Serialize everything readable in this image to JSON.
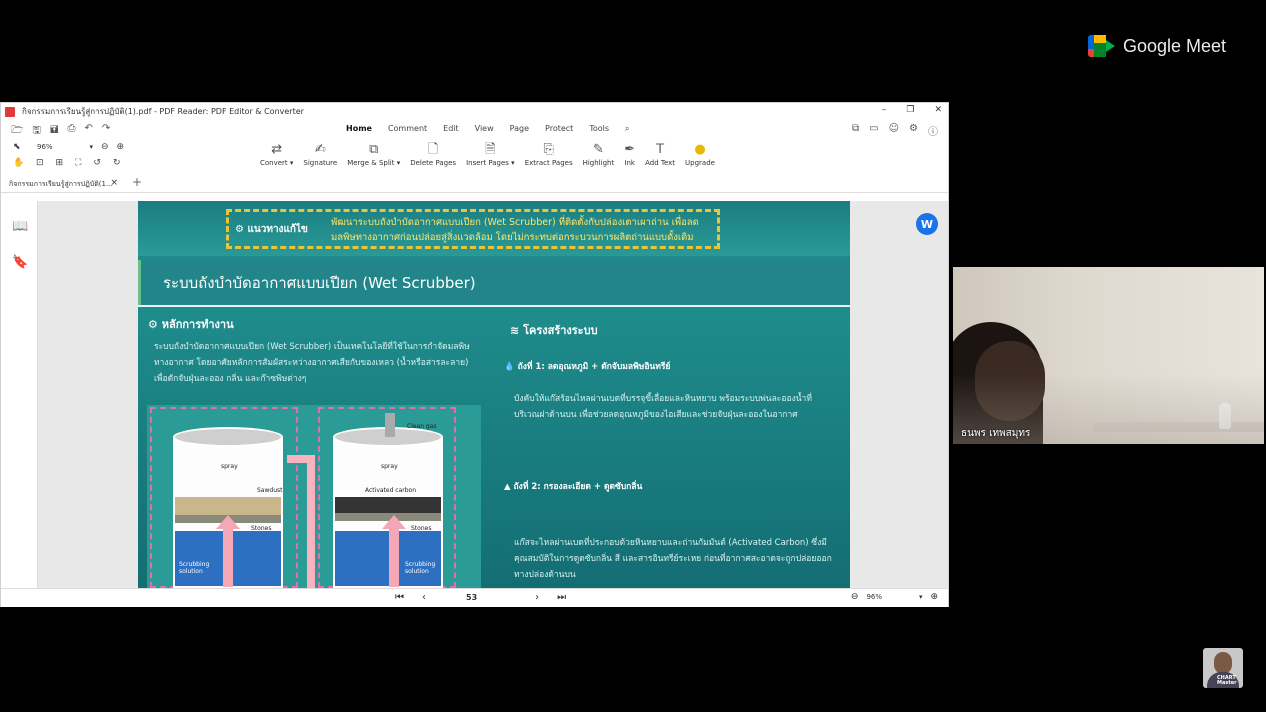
{
  "meet": {
    "brand": "Google Meet"
  },
  "window": {
    "title": "กิจกรรมการเรียนรู้สู่การปฏิบัติ(1).pdf - PDF Reader: PDF Editor & Converter",
    "controls": [
      "–",
      "❐",
      "✕"
    ]
  },
  "menu": {
    "items": [
      "Home",
      "Comment",
      "Edit",
      "View",
      "Page",
      "Protect",
      "Tools"
    ],
    "active": "Home"
  },
  "toolbar": {
    "zoom": "96%",
    "tools": [
      {
        "label": "Convert ▾",
        "icon": "convert-icon"
      },
      {
        "label": "Signature",
        "icon": "signature-icon"
      },
      {
        "label": "Merge & Split ▾",
        "icon": "merge-icon"
      },
      {
        "label": "Delete Pages",
        "icon": "delete-pages-icon"
      },
      {
        "label": "Insert Pages ▾",
        "icon": "insert-pages-icon"
      },
      {
        "label": "Extract Pages",
        "icon": "extract-pages-icon"
      },
      {
        "label": "Highlight",
        "icon": "highlight-icon"
      },
      {
        "label": "Ink",
        "icon": "ink-icon"
      },
      {
        "label": "Add Text",
        "icon": "add-text-icon"
      },
      {
        "label": "Upgrade",
        "icon": "upgrade-icon"
      }
    ]
  },
  "tab": {
    "label": "กิจกรรมการเรียนรู้สู่การปฏิบัติ(1..."
  },
  "viewer_avatar": "W",
  "pdf": {
    "solution_label": "แนวทางแก้ไข",
    "solution_text": "พัฒนาระบบถังบำบัดอากาศแบบเปียก (Wet Scrubber) ที่ติดตั้งกับปล่องเตาเผาถ่าน เพื่อลดมลพิษทางอากาศก่อนปล่อยสู่สิ่งแวดล้อม โดยไม่กระทบต่อกระบวนการผลิตถ่านแบบดั้งเดิม",
    "title": "ระบบถังบำบัดอากาศแบบเปียก (Wet Scrubber)",
    "principle_head": "หลักการทำงาน",
    "principle_text": "ระบบถังบำบัดอากาศแบบเปียก (Wet Scrubber) เป็นเทคโนโลยีที่ใช้ในการกำจัดมลพิษทางอากาศ โดยอาศัยหลักการสัมผัสระหว่างอากาศเสียกับของเหลว (น้ำหรือสารละลาย) เพื่อดักจับฝุ่นละออง กลิ่น และก๊าซพิษต่างๆ",
    "structure_head": "โครงสร้างระบบ",
    "step1_head": "ถังที่ 1: ลดอุณหภูมิ + ดักจับมลพิษอินทรีย์",
    "step1_text": "บังคับให้แก๊สร้อนไหลผ่านเบดที่บรรจุขี้เลื่อยและหินหยาบ พร้อมระบบพ่นละอองน้ำที่บริเวณฝาด้านบน เพื่อช่วยลดอุณหภูมิของไอเสียและช่วยจับฝุ่นละอองในอากาศ",
    "step2_head": "ถังที่ 2: กรองละเอียด + ดูดซับกลิ่น",
    "step2_text": "แก๊สจะไหลผ่านเบดที่ประกอบด้วยหินหยาบและถ่านกัมมันต์ (Activated Carbon) ซึ่งมีคุณสมบัติในการดูดซับกลิ่น สี และสารอินทรีย์ระเหย ก่อนที่อากาศสะอาดจะถูกปล่อยออกทางปล่องด้านบน",
    "diagram": {
      "tank1": {
        "top": "spray",
        "layer": "Sawdust",
        "stones": "Stones",
        "liquid": "Scrubbing solution"
      },
      "tank2": {
        "gas": "Clean gas",
        "top": "spray",
        "layer": "Activated carbon",
        "stones": "Stones",
        "liquid": "Scrubbing solution"
      }
    }
  },
  "status": {
    "page": "53",
    "zoom": "96%"
  },
  "participant": {
    "name": "ธนพร เทพสมุทร"
  },
  "self_badge": "CHART\nMaster"
}
